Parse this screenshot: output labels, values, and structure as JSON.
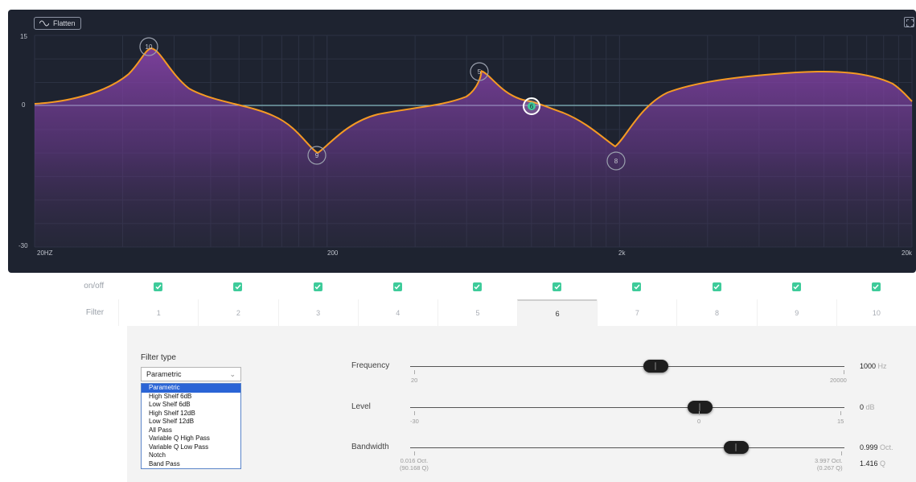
{
  "toolbar": {
    "flatten_label": "Flatten",
    "flatten_icon": "wave-icon",
    "expand_icon": "expand-icon"
  },
  "graph": {
    "y_labels": [
      "15",
      "0",
      "-30"
    ],
    "x_labels": [
      "20HZ",
      "200",
      "2k",
      "20k"
    ],
    "colors": {
      "curve": "#f59a23",
      "fill": "#7a3e98",
      "flat_line": "#3ecb9a",
      "background": "#1e2330"
    },
    "nodes": [
      "10",
      "9",
      "6",
      "5",
      "8"
    ],
    "active_node": "6"
  },
  "table": {
    "onoff_label": "on/off",
    "filter_label": "Filter",
    "filters": [
      "1",
      "2",
      "3",
      "4",
      "5",
      "6",
      "7",
      "8",
      "9",
      "10"
    ],
    "enabled": [
      true,
      true,
      true,
      true,
      true,
      true,
      true,
      true,
      true,
      true
    ],
    "active_filter": "6"
  },
  "filter_type": {
    "label": "Filter type",
    "selected": "Parametric",
    "options": [
      "Parametric",
      "High Shelf 6dB",
      "Low Shelf 6dB",
      "High Shelf 12dB",
      "Low Shelf 12dB",
      "All Pass",
      "Variable Q High Pass",
      "Variable Q Low Pass",
      "Notch",
      "Band Pass"
    ]
  },
  "frequency": {
    "label": "Frequency",
    "min": "20",
    "max": "20000",
    "value": "1000",
    "unit": "Hz",
    "position": 0.565
  },
  "level": {
    "label": "Level",
    "min": "-30",
    "mid": "0",
    "max": "15",
    "value": "0",
    "unit": "dB",
    "position": 0.667
  },
  "bandwidth": {
    "label": "Bandwidth",
    "min_oct": "0.016 Oct.",
    "min_q": "(90.168 Q)",
    "max_oct": "3.997 Oct.",
    "max_q": "(0.267 Q)",
    "value": "0.999",
    "unit": "Oct.",
    "q_value": "1.416",
    "q_unit": "Q",
    "position": 0.75
  }
}
